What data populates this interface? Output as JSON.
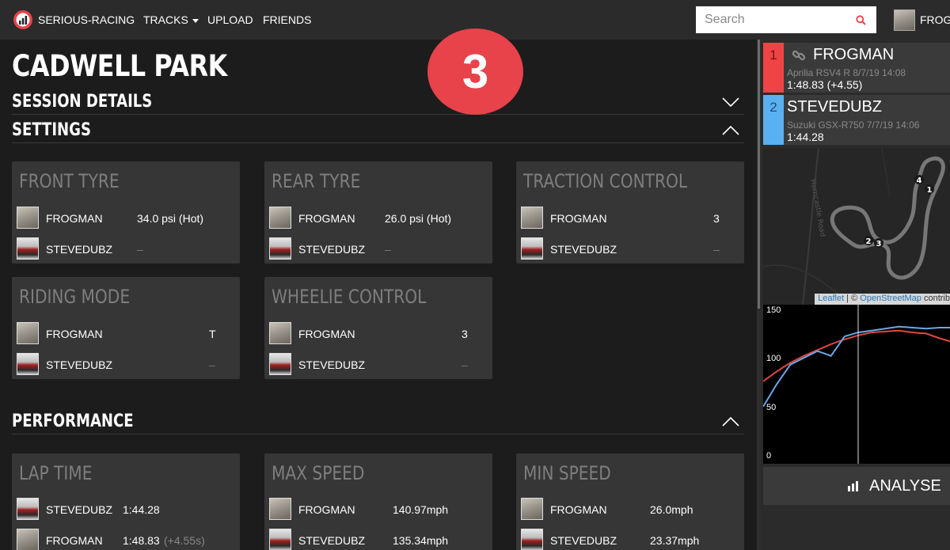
{
  "nav": {
    "brand": "SERIOUS-RACING",
    "tracks": "TRACKS",
    "upload": "UPLOAD",
    "friends": "FRIENDS",
    "search_placeholder": "Search",
    "user": "FROGMAN",
    "accent": "#e8424a"
  },
  "page": {
    "title": "CADWELL PARK",
    "badge": "3"
  },
  "sections": {
    "session_details": "SESSION DETAILS",
    "settings": "SETTINGS",
    "performance": "PERFORMANCE"
  },
  "settings": {
    "front_tyre": {
      "title": "FRONT TYRE",
      "rows": [
        {
          "rider": "FROGMAN",
          "value": "34.0 psi (Hot)"
        },
        {
          "rider": "STEVEDUBZ",
          "value": "–"
        }
      ]
    },
    "rear_tyre": {
      "title": "REAR TYRE",
      "rows": [
        {
          "rider": "FROGMAN",
          "value": "26.0 psi (Hot)"
        },
        {
          "rider": "STEVEDUBZ",
          "value": "–"
        }
      ]
    },
    "traction_control": {
      "title": "TRACTION CONTROL",
      "rows": [
        {
          "rider": "FROGMAN",
          "value": "3"
        },
        {
          "rider": "STEVEDUBZ",
          "value": "–"
        }
      ]
    },
    "riding_mode": {
      "title": "RIDING MODE",
      "rows": [
        {
          "rider": "FROGMAN",
          "value": "T"
        },
        {
          "rider": "STEVEDUBZ",
          "value": "–"
        }
      ]
    },
    "wheelie_control": {
      "title": "WHEELIE CONTROL",
      "rows": [
        {
          "rider": "FROGMAN",
          "value": "3"
        },
        {
          "rider": "STEVEDUBZ",
          "value": "–"
        }
      ]
    }
  },
  "performance": {
    "lap_time": {
      "title": "LAP TIME",
      "rows": [
        {
          "rider": "STEVEDUBZ",
          "value": "1:44.28",
          "extra": ""
        },
        {
          "rider": "FROGMAN",
          "value": "1:48.83",
          "extra": "(+4.55s)"
        }
      ]
    },
    "max_speed": {
      "title": "MAX SPEED",
      "rows": [
        {
          "rider": "FROGMAN",
          "value": "140.97mph"
        },
        {
          "rider": "STEVEDUBZ",
          "value": "135.34mph"
        }
      ]
    },
    "min_speed": {
      "title": "MIN SPEED",
      "rows": [
        {
          "rider": "FROGMAN",
          "value": "26.0mph"
        },
        {
          "rider": "STEVEDUBZ",
          "value": "23.37mph"
        }
      ]
    }
  },
  "riders": [
    {
      "num": "1",
      "name": "FROGMAN",
      "bike": "Aprilia RSV4 R 8/7/19 14:08",
      "lap": "1:48.83 (+4.55)",
      "color": "#ef4444"
    },
    {
      "num": "2",
      "name": "STEVEDUBZ",
      "bike": "Suzuki GSX-R750 7/7/19 14:06",
      "lap": "1:44.28",
      "color": "#5ab0f0"
    }
  ],
  "map": {
    "road_label": "Horncastle Road",
    "markers": [
      "1",
      "2",
      "3",
      "4"
    ],
    "attribution_leaflet": "Leaflet",
    "attribution_sep": " | © ",
    "attribution_osm": "OpenStreetMap",
    "attribution_rest": " contrib"
  },
  "chart_data": {
    "type": "line",
    "yticks": [
      "150",
      "100",
      "50",
      "0"
    ],
    "ylim": [
      0,
      150
    ],
    "series": [
      {
        "color": "#e0463e",
        "values": [
          78,
          88,
          97,
          104,
          110,
          116,
          121,
          125,
          128,
          129,
          130,
          128,
          127,
          122,
          118
        ]
      },
      {
        "color": "#6aa8e8",
        "values": [
          52,
          75,
          95,
          102,
          109,
          104,
          124,
          128,
          130,
          132,
          134,
          133,
          132,
          133,
          133
        ]
      }
    ],
    "cursor_index": 7
  },
  "analyse": {
    "label": "ANALYSE"
  }
}
